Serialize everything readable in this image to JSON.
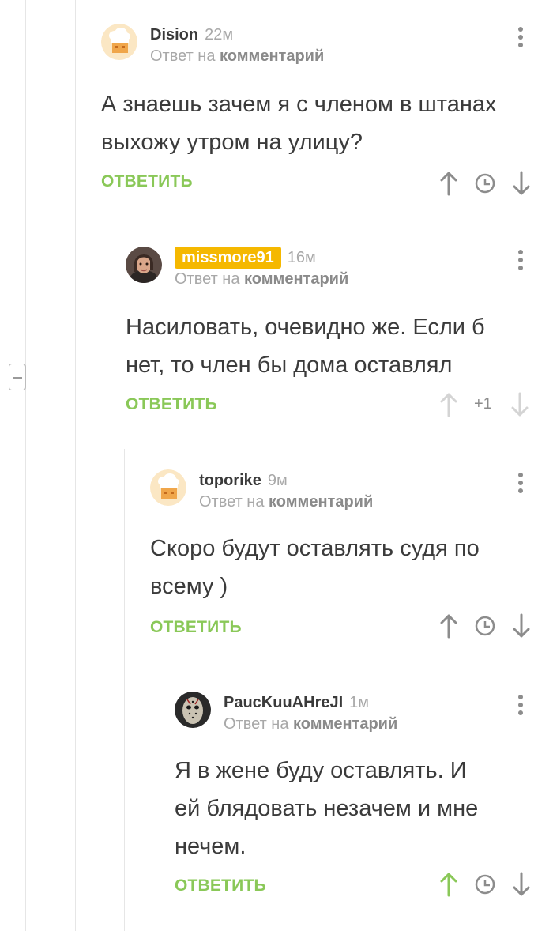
{
  "reply_button_label": "ОТВЕТИТЬ",
  "reply_prefix": "Ответ на",
  "reply_target": "комментарий",
  "colors": {
    "accent_green": "#8ac858",
    "badge_yellow": "#f5b800",
    "muted_text": "#a8a8a8",
    "body_text": "#3b3b3b"
  },
  "comments": [
    {
      "author": "Dision",
      "time": "22м",
      "text_lines": [
        "А знаешь зачем я с членом в штанах",
        "выхожу утром на улицу?"
      ],
      "rating": "",
      "avatar_icon": "chef-hat-avatar-icon"
    },
    {
      "author": "missmore91",
      "time": "16м",
      "text_lines": [
        "Насиловать, очевидно же. Если б",
        "нет, то член бы дома оставлял"
      ],
      "rating": "+1",
      "avatar_icon": "user-photo-avatar"
    },
    {
      "author": "toporike",
      "time": "9м",
      "text_lines": [
        "Скоро будут оставлять судя по",
        "всему )"
      ],
      "rating": "",
      "avatar_icon": "chef-hat-avatar-icon"
    },
    {
      "author": "PaucKuuAHreJI",
      "time": "1м",
      "text_lines": [
        "Я в жене буду оставлять. И",
        "ей блядовать незачем и мне",
        "нечем."
      ],
      "rating": "",
      "avatar_icon": "hockey-mask-avatar"
    }
  ]
}
